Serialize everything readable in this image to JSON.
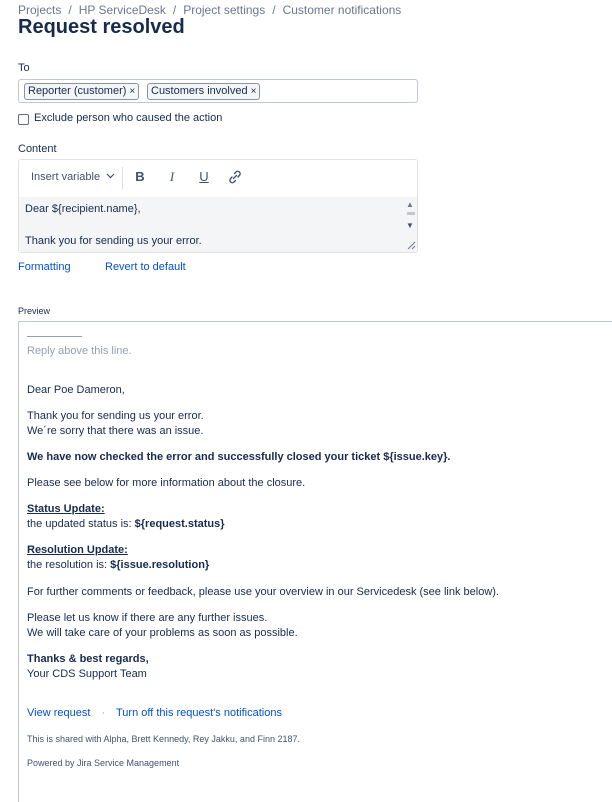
{
  "breadcrumb": [
    "Projects",
    "HP ServiceDesk",
    "Project settings",
    "Customer notifications"
  ],
  "page": {
    "title": "Request resolved"
  },
  "to": {
    "label": "To",
    "recipients": [
      "Reporter (customer)",
      "Customers involved"
    ],
    "remove_glyph": "×"
  },
  "exclude": {
    "label": "Exclude person who caused the action",
    "checked": false
  },
  "content": {
    "label": "Content",
    "toolbar": {
      "insert_variable": "Insert variable",
      "bold": "B",
      "italic": "I",
      "underline": "U"
    },
    "lines": [
      "Dear ${recipient.name},",
      "Thank you for sending us your error."
    ],
    "scroll_up": "▲",
    "scroll_down": "▼"
  },
  "links": {
    "formatting": "Formatting",
    "revert": "Revert to default"
  },
  "preview": {
    "label": "Preview",
    "reply_above": "Reply above this line.",
    "greeting": "Dear Poe Dameron,",
    "thanks_1": "Thank you for sending us your error.",
    "thanks_2": "We´re sorry that there was an issue.",
    "closed": "We have now checked the error and successfully closed your ticket ${issue.key}.",
    "see_below": "Please see below for more information about the closure.",
    "status_heading": "Status Update:",
    "status_text": "the updated status is: ",
    "status_var": "${request.status}",
    "resolution_heading": "Resolution Update:",
    "resolution_text": "the resolution is: ",
    "resolution_var": "${issue.resolution}",
    "further": "For further comments or feedback, please use your overview in our Servicedesk (see link below).",
    "let_us_know": "Please let us know if there are any further issues.",
    "take_care": "We will take care of your problems as soon as possible.",
    "regards": "Thanks & best regards,",
    "team": "Your CDS Support Team",
    "view_request": "View request",
    "dot": "·",
    "turn_off": "Turn off this request's notifications",
    "shared": "This is shared with Alpha, Brett Kennedy, Rey Jakku, and Finn 2187.",
    "powered": "Powered by Jira Service Management"
  },
  "colors": {
    "link": "#0052cc",
    "text": "#172b4d",
    "muted": "#97a0af",
    "editor_bg": "#f4f5f7"
  },
  "icons": [
    "chevron-down-icon",
    "link-icon",
    "close-icon",
    "resize-grip-icon"
  ]
}
